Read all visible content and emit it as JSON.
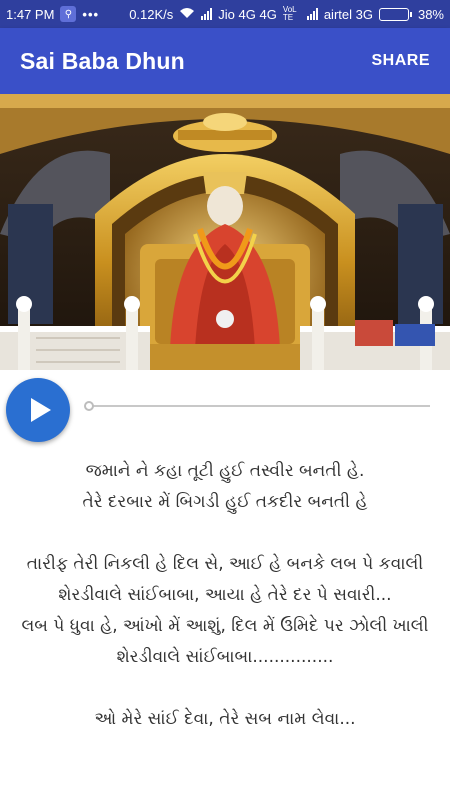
{
  "status_bar": {
    "time": "1:47 PM",
    "speed": "0.12K/s",
    "carrier1": "Jio 4G 4G",
    "volte": "VoLTE",
    "carrier2": "airtel 3G",
    "battery": "38%",
    "battery_level": 0.38
  },
  "app_bar": {
    "title": "Sai Baba Dhun",
    "share_label": "SHARE"
  },
  "player": {
    "progress": 0
  },
  "lyrics": [
    "જમાને  ને કહા તૂટી હુઈ  તસ્વીર  બનતી હે.",
    "તેરે દરબાર મેં બિગડી હુઈ તકદીર બનતી હે",
    "",
    "તારીફ તેરી નિકલી હે દિલ સે, આઈ હે બનકે લબ પે કવાલી",
    "શેરડીવાલે સાંઈબાબા, આયા હે તેરે દર પે સવારી...",
    "લબ પે ધુવા હે, આંખો મેં આશું, દિલ મેં ઉમિદે પર ઝોલી ખાલી",
    "શેરડીવાલે સાંઈબાબા...............",
    "",
    "ઓ મેરે સાંઈ દેવા, તેરે સબ નામ લેવા..."
  ]
}
